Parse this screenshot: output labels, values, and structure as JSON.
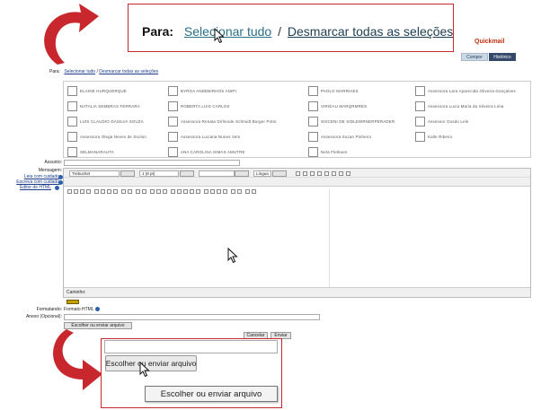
{
  "callout_top": {
    "para_label": "Para:",
    "select_all": "Selecionar tudo",
    "separator": "/",
    "deselect_all": "Desmarcar todas as seleções"
  },
  "header": {
    "app_name": "Quickmail",
    "tab_compose": "Compor",
    "tab_history": "Histórico"
  },
  "para_row": {
    "label": "Para:",
    "select_all": "Selecionar tudo",
    "separator": "/",
    "deselect_all": "Desmarcar todas as seleções"
  },
  "recipients": [
    [
      "ELAINE HURQUERQUE",
      "BYRGA ANDEBIRHOS ANIPI",
      "PAOLO MARRIAES",
      "Assessora Lara Aparecida Oliveira Gonçalves"
    ],
    [
      "NATALIA SEMBRAS FERRARA",
      "ROBERTA LUIS CARLOS",
      "VIRIEAU MARQRMRES",
      "Assessora Lucia Maria da Silveira Lima"
    ],
    [
      "LUIS CLAUDIO DASILVA SOUZA",
      "Assessora Renata Dirlinnde Schmidt Burger Pinto",
      "SISCENI DE SIDLEWRNERPERADER",
      "Assessor Gusdo Lele"
    ],
    [
      "Assessora Olega Neves de Ssolon",
      "Assessora Luciana Nunes Velo",
      "Assessora Suzan Pinheiro",
      "Kalle Ribeiro"
    ],
    [
      "SELMANARAUTA",
      "ANA CAROLINA SIMAS AMUTRE",
      "Nela Fletkues"
    ]
  ],
  "form": {
    "assunto_label": "Assunto:",
    "mensagem_label": "Mensagem:",
    "link_leia": "Leia com cuidado",
    "link_escreva": "Escreva com cuidado",
    "link_editor": "Editor de HTML",
    "font_select": "Trebuchet",
    "size_select": "1 (8 pt)",
    "lang_select": "Língua",
    "caminho_label": "Caminho:",
    "formatando_label": "Formatando:",
    "formato_value": "Formato HTML",
    "anexo_label": "Anexo (Opcional):",
    "escolher_button": "Escolher ou enviar arquivo",
    "cancelar_button": "Cancelar",
    "enviar_button": "Enviar"
  },
  "callout_bottom": {
    "button": "Escolher ou enviar arquivo",
    "tooltip": "Escolher ou enviar arquivo"
  },
  "colors": {
    "callout_border": "#c8282d",
    "arrow": "#c8282d",
    "link": "#2a6e86",
    "tab_active": "#34496a"
  }
}
